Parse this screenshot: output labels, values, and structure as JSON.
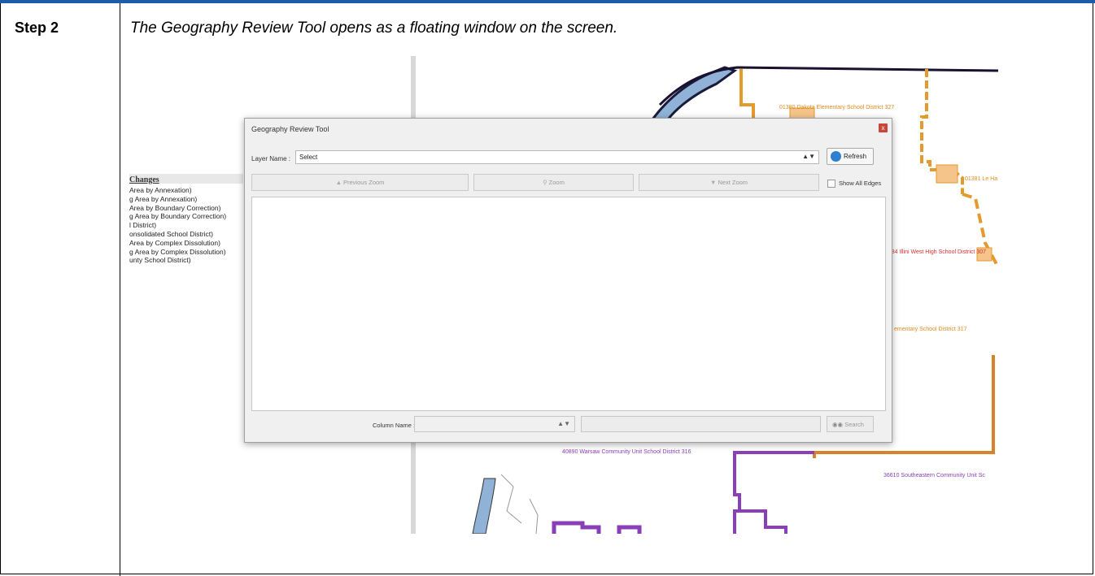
{
  "step": {
    "label": "Step 2",
    "instruction": "The Geography Review Tool opens as a floating window on the screen."
  },
  "legend": {
    "title": "Changes",
    "items": [
      "Area by Annexation)",
      "g Area by Annexation)",
      "Area by Boundary Correction)",
      "g Area by Boundary Correction)",
      "l District)",
      "onsolidated School District)",
      "Area by Complex Dissolution)",
      "g Area by Complex Dissolution)",
      "unty School District)"
    ]
  },
  "map": {
    "labels": [
      "01380 Dakota Elementary School District 327",
      "01381 Le Ha",
      "1384 Illini West High School District 307",
      "ementary School District 317",
      "40890 Warsaw Community Unit School District 316",
      "36610 Southeastern Community Unit Sc"
    ]
  },
  "dialog": {
    "title": "Geography Review Tool",
    "close_glyph": "x",
    "layer_name_label": "Layer Name :",
    "layer_select_value": "Select",
    "select_arrow": "▲▼",
    "refresh_label": "Refresh",
    "previous_zoom_label": "Previous Zoom",
    "zoom_label": "Zoom",
    "next_zoom_label": "Next Zoom",
    "show_all_edges_label": "Show All Edges",
    "column_name_label": "Column Name :",
    "search_label": "Search"
  },
  "colors": {
    "accent_bar": "#1f5aa8",
    "orange_boundary": "#e59a2e",
    "purple_boundary": "#8a3fb8",
    "river": "#8fb2d6",
    "close_button": "#c8453a"
  }
}
